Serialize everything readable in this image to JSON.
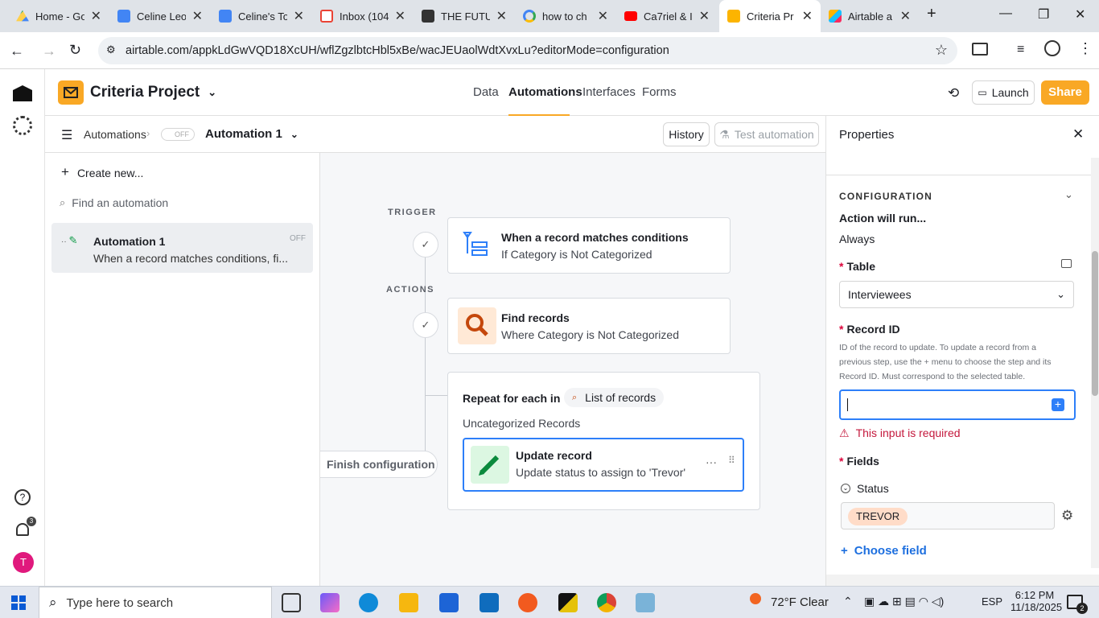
{
  "browser": {
    "tabs": [
      {
        "label": "Home - Go",
        "icon": "google-drive-icon",
        "active": false
      },
      {
        "label": "Celine Leo",
        "icon": "google-docs-icon",
        "active": false
      },
      {
        "label": "Celine's To",
        "icon": "google-docs-icon",
        "active": false
      },
      {
        "label": "Inbox (104",
        "icon": "gmail-icon",
        "active": false
      },
      {
        "label": "THE FUTU",
        "icon": "notion-icon",
        "active": false
      },
      {
        "label": "how to ch",
        "icon": "google-search-icon",
        "active": false
      },
      {
        "label": "Ca7riel & I",
        "icon": "youtube-icon",
        "active": false
      },
      {
        "label": "Criteria Pr",
        "icon": "airtable-icon",
        "active": true
      },
      {
        "label": "Airtable a",
        "icon": "airtable-icon",
        "active": false
      }
    ],
    "url": "airtable.com/appkLdGwVQD18XcUH/wflZgzlbtcHbl5xBe/wacJEUaolWdtXvxLu?editorMode=configuration"
  },
  "app": {
    "base_name": "Criteria Project",
    "nav_tabs": [
      "Data",
      "Automations",
      "Interfaces",
      "Forms"
    ],
    "active_tab": "Automations",
    "launch_label": "Launch",
    "share_label": "Share",
    "accent_color": "#f82b60",
    "share_color": "#f9a825"
  },
  "subheader": {
    "breadcrumb_root": "Automations",
    "toggle_state": "OFF",
    "automation_name": "Automation 1",
    "history_label": "History",
    "test_label": "Test automation"
  },
  "sidebar": {
    "create_label": "Create new...",
    "search_placeholder": "Find an automation",
    "items": [
      {
        "title": "Automation 1",
        "subtitle": "When a record matches conditions, fi...",
        "status": "OFF"
      }
    ]
  },
  "canvas": {
    "trigger_label": "TRIGGER",
    "actions_label": "ACTIONS",
    "trigger": {
      "title": "When a record matches conditions",
      "subtitle": "If Category is Not Categorized"
    },
    "find": {
      "title": "Find records",
      "subtitle": "Where Category is Not Categorized"
    },
    "repeat": {
      "label": "Repeat for each in",
      "list_chip": "List of records",
      "subtitle": "Uncategorized Records"
    },
    "update": {
      "title": "Update record",
      "subtitle": "Update status to assign to 'Trevor'"
    },
    "finish_label": "Finish configuration"
  },
  "properties": {
    "title": "Properties",
    "section": "CONFIGURATION",
    "will_run_label": "Action will run...",
    "will_run_value": "Always",
    "table_label": "Table",
    "table_value": "Interviewees",
    "record_id_label": "Record ID",
    "record_id_help": "ID of the record to update. To update a record from a previous step, use the + menu to choose the step and its Record ID. Must correspond to the selected table.",
    "record_id_value": "",
    "error_text": "This input is required",
    "fields_label": "Fields",
    "status_label": "Status",
    "status_value": "TREVOR",
    "choose_field_label": "Choose field"
  },
  "rail": {
    "notification_count": "3",
    "avatar_initial": "T"
  },
  "taskbar": {
    "search_placeholder": "Type here to search",
    "weather": "72°F  Clear",
    "language": "ESP",
    "time": "6:12 PM",
    "date": "11/18/2025",
    "notif_count": "2"
  }
}
